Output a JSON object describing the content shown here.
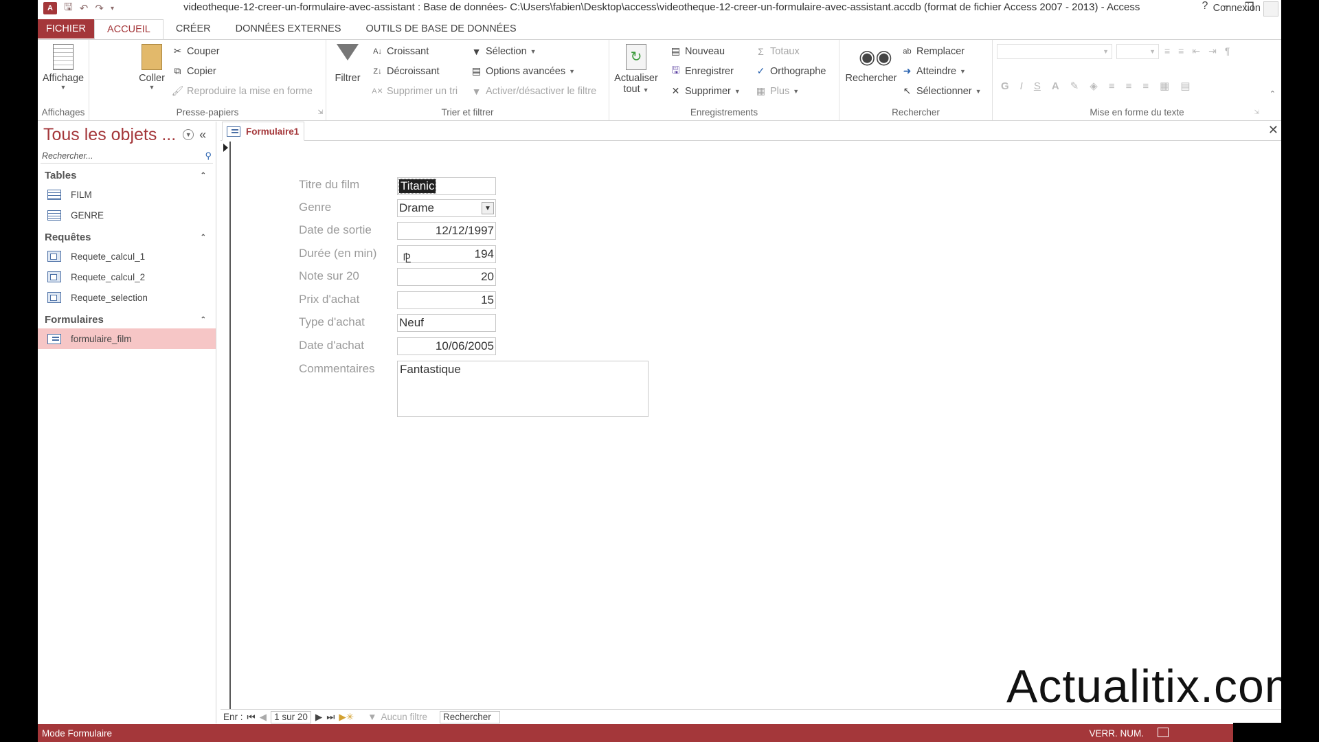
{
  "app": {
    "icon_label": "A",
    "title": "videotheque-12-creer-un-formulaire-avec-assistant : Base de données- C:\\Users\\fabien\\Desktop\\access\\videotheque-12-creer-un-formulaire-avec-assistant.accdb (format de fichier Access 2007 - 2013) - Access",
    "connexion": "Connexion"
  },
  "tabs": [
    "FICHIER",
    "ACCUEIL",
    "CRÉER",
    "DONNÉES EXTERNES",
    "OUTILS DE BASE DE DONNÉES"
  ],
  "ribbon": {
    "affichages": {
      "label": "Affichages",
      "affichage": "Affichage"
    },
    "presse_papiers": {
      "label": "Presse-papiers",
      "coller": "Coller",
      "couper": "Couper",
      "copier": "Copier",
      "reproduire": "Reproduire la mise en forme"
    },
    "trier_filtrer": {
      "label": "Trier et filtrer",
      "filtrer": "Filtrer",
      "croissant": "Croissant",
      "decroissant": "Décroissant",
      "supprimer_tri": "Supprimer un tri",
      "selection": "Sélection",
      "options_avancees": "Options avancées",
      "activer_filtre": "Activer/désactiver le filtre"
    },
    "enregistrements": {
      "label": "Enregistrements",
      "actualiser": "Actualiser",
      "tout": "tout",
      "nouveau": "Nouveau",
      "enregistrer": "Enregistrer",
      "supprimer": "Supprimer",
      "totaux": "Totaux",
      "orthographe": "Orthographe",
      "plus": "Plus"
    },
    "rechercher": {
      "label": "Rechercher",
      "rechercher": "Rechercher",
      "remplacer": "Remplacer",
      "atteindre": "Atteindre",
      "selectionner": "Sélectionner"
    },
    "mise_en_forme": {
      "label": "Mise en forme du texte",
      "bold": "G",
      "italic": "I",
      "underline": "S",
      "font_color": "A"
    }
  },
  "nav": {
    "title": "Tous les objets ...",
    "search_placeholder": "Rechercher...",
    "sections": [
      {
        "label": "Tables",
        "items": [
          "FILM",
          "GENRE"
        ]
      },
      {
        "label": "Requêtes",
        "items": [
          "Requete_calcul_1",
          "Requete_calcul_2",
          "Requete_selection"
        ]
      },
      {
        "label": "Formulaires",
        "items": [
          "formulaire_film"
        ]
      }
    ]
  },
  "document": {
    "tab_label": "Formulaire1",
    "fields": [
      {
        "label": "Titre du film",
        "value": "Titanic"
      },
      {
        "label": "Genre",
        "value": "Drame"
      },
      {
        "label": "Date de sortie",
        "value": "12/12/1997"
      },
      {
        "label": "Durée (en min)",
        "value": "194"
      },
      {
        "label": "Note sur 20",
        "value": "20"
      },
      {
        "label": "Prix d'achat",
        "value": "15"
      },
      {
        "label": "Type d'achat",
        "value": "Neuf"
      },
      {
        "label": "Date d'achat",
        "value": "10/06/2005"
      },
      {
        "label": "Commentaires",
        "value": "Fantastique"
      }
    ]
  },
  "record_nav": {
    "prefix": "Enr :",
    "position": "1 sur 20",
    "filter": "Aucun filtre",
    "search": "Rechercher"
  },
  "watermark": "Actualitix.com",
  "status": {
    "mode": "Mode Formulaire",
    "right": "VERR. NUM."
  },
  "colors": {
    "accent": "#a4373a",
    "selected_nav": "#f6c6c6"
  }
}
